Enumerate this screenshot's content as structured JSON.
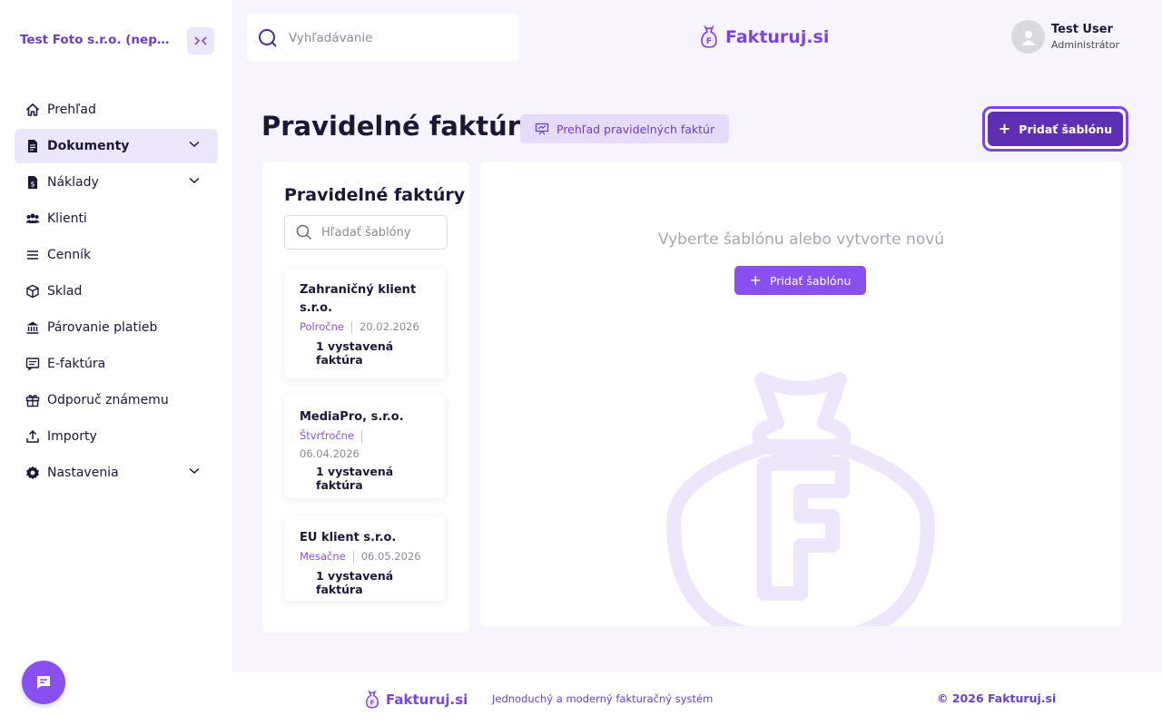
{
  "company": {
    "name": "Test Foto s.r.o. (neplatiteľ DPH)"
  },
  "search": {
    "placeholder": "Vyhľadávanie"
  },
  "brand": {
    "name": "Fakturuj.si",
    "accent": "#7a45e0"
  },
  "user": {
    "name": "Test User",
    "role": "Administrátor"
  },
  "nav": {
    "items": [
      {
        "label": "Prehľad",
        "icon": "home-icon"
      },
      {
        "label": "Dokumenty",
        "icon": "document-icon",
        "expandable": true,
        "active": true
      },
      {
        "label": "Náklady",
        "icon": "receipt-icon",
        "expandable": true
      },
      {
        "label": "Klienti",
        "icon": "users-icon"
      },
      {
        "label": "Cenník",
        "icon": "list-icon"
      },
      {
        "label": "Sklad",
        "icon": "box-icon"
      },
      {
        "label": "Párovanie platieb",
        "icon": "bank-icon"
      },
      {
        "label": "E-faktúra",
        "icon": "message-icon"
      },
      {
        "label": "Odporuč známemu",
        "icon": "gift-icon"
      },
      {
        "label": "Importy",
        "icon": "upload-icon"
      },
      {
        "label": "Nastavenia",
        "icon": "gear-icon",
        "expandable": true
      }
    ]
  },
  "page": {
    "title": "Pravidelné faktúry",
    "overview_button": "Prehľad pravidelných faktúr",
    "add_button": "Pridať šablónu"
  },
  "list": {
    "title": "Pravidelné faktúry",
    "search_placeholder": "Hľadať šablóny",
    "templates": [
      {
        "name": "Zahraničný klient s.r.o.",
        "frequency": "Polročne",
        "date": "20.02.2026",
        "count": "1 vystavená faktúra"
      },
      {
        "name": "MediaPro, s.r.o.",
        "frequency": "Štvrťročne",
        "date": "06.04.2026",
        "count": "1 vystavená faktúra"
      },
      {
        "name": "EU klient s.r.o.",
        "frequency": "Mesačne",
        "date": "06.05.2026",
        "count": "1 vystavená faktúra"
      }
    ]
  },
  "detail": {
    "empty_message": "Vyberte šablónu alebo vytvorte novú",
    "add_button": "Pridať šablónu"
  },
  "footer": {
    "brand": "Fakturuj.si",
    "tagline": "Jednoduchý a moderný fakturačný systém",
    "copyright": "© 2026 Fakturuj.si"
  }
}
